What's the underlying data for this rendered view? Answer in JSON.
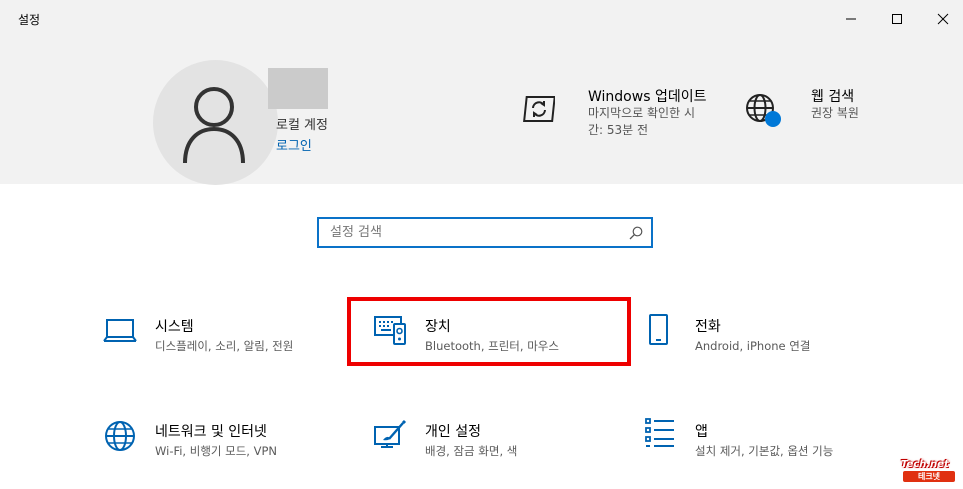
{
  "window": {
    "title": "설정",
    "minimize_icon": "minimize-icon",
    "maximize_icon": "maximize-icon",
    "close_icon": "close-icon"
  },
  "account": {
    "type": "로컬 계정",
    "signin_label": "로그인",
    "avatar_icon": "person-icon"
  },
  "header_items": [
    {
      "title": "Windows 업데이트",
      "subtitle_line1": "마지막으로 확인한 시",
      "subtitle_line2": "간: 53분 전",
      "icon": "sync-icon"
    },
    {
      "title": "웹 검색",
      "subtitle": "권장 복원",
      "icon": "globe-icon",
      "badge_color": "#0078d7"
    }
  ],
  "search": {
    "placeholder": "설정 검색",
    "value": "",
    "icon": "search-icon"
  },
  "accent_color": "#0063b1",
  "highlight_color": "#ee0000",
  "categories": [
    {
      "title": "시스템",
      "subtitle": "디스플레이, 소리, 알림, 전원",
      "icon": "laptop-icon"
    },
    {
      "title": "장치",
      "subtitle": "Bluetooth, 프린터, 마우스",
      "icon": "devices-icon",
      "highlighted": true
    },
    {
      "title": "전화",
      "subtitle": "Android, iPhone 연결",
      "icon": "phone-icon"
    },
    {
      "title": "네트워크 및 인터넷",
      "subtitle": "Wi-Fi, 비행기 모드, VPN",
      "icon": "globe-icon"
    },
    {
      "title": "개인 설정",
      "subtitle": "배경, 잠금 화면, 색",
      "icon": "personalization-icon"
    },
    {
      "title": "앱",
      "subtitle": "설치 제거, 기본값, 옵션 기능",
      "icon": "apps-list-icon"
    }
  ],
  "watermark": {
    "line1": "Tech.net",
    "line2": "테크넷"
  }
}
